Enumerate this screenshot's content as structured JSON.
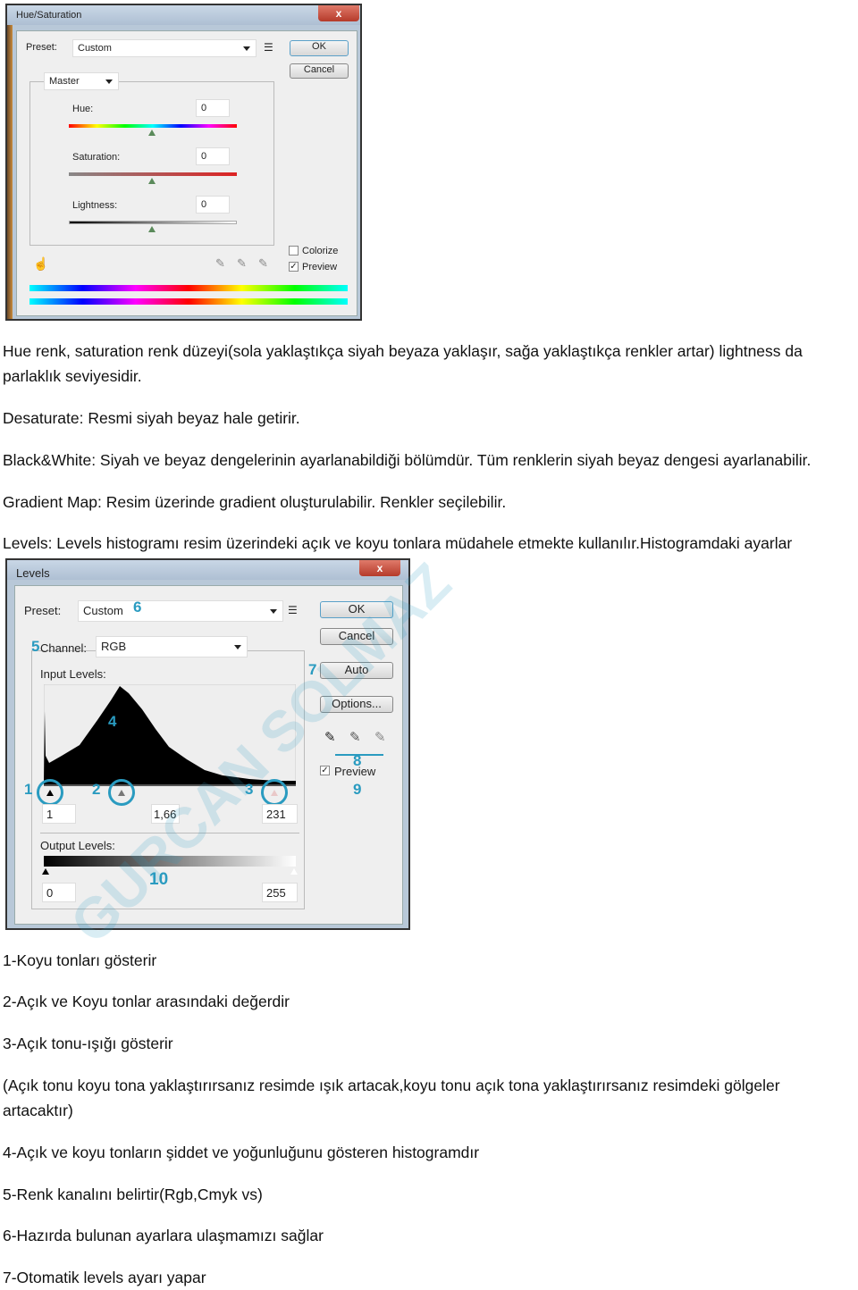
{
  "hue_dialog": {
    "title": "Hue/Saturation",
    "close": "x",
    "preset_label": "Preset:",
    "preset_value": "Custom",
    "ok": "OK",
    "cancel": "Cancel",
    "channel": "Master",
    "hue_label": "Hue:",
    "hue_value": "0",
    "saturation_label": "Saturation:",
    "saturation_value": "0",
    "lightness_label": "Lightness:",
    "lightness_value": "0",
    "colorize_label": "Colorize",
    "colorize_checked": false,
    "preview_label": "Preview",
    "preview_checked": true,
    "icons": [
      "hand-adjust-icon",
      "eyedropper-icon",
      "eyedropper-plus-icon",
      "eyedropper-minus-icon",
      "preset-menu-icon"
    ]
  },
  "paragraphs": [
    "Hue renk, saturation renk düzeyi(sola yaklaştıkça siyah beyaza yaklaşır, sağa yaklaştıkça renkler artar) lightness da",
    "parlaklık seviyesidir.",
    "Desaturate: Resmi siyah beyaz hale getirir.",
    "Black&White: Siyah ve beyaz dengelerinin ayarlanabildiği bölümdür. Tüm renklerin siyah beyaz dengesi ayarlanabilir.",
    "Gradient Map: Resim üzerinde gradient oluşturulabilir. Renkler seçilebilir.",
    "Levels: Levels histogramı resim üzerindeki açık ve koyu tonlara müdahele etmekte kullanılır.Histogramdaki ayarlar"
  ],
  "levels_dialog": {
    "title": "Levels",
    "close": "x",
    "preset_label": "Preset:",
    "preset_value": "Custom",
    "channel_label": "Channel:",
    "channel_value": "RGB",
    "input_levels_label": "Input Levels:",
    "input_black": "1",
    "input_gamma": "1,66",
    "input_white": "231",
    "output_levels_label": "Output Levels:",
    "output_black": "0",
    "output_white": "255",
    "ok": "OK",
    "cancel": "Cancel",
    "auto": "Auto",
    "options": "Options...",
    "preview_label": "Preview",
    "preview_checked": true,
    "watermark": "GURCAN SOLMAZ",
    "markers": [
      "1",
      "2",
      "3",
      "4",
      "5",
      "6",
      "7",
      "8",
      "9",
      "10"
    ],
    "accent": "#2a9bc0"
  },
  "list": [
    "1-Koyu tonları gösterir",
    "2-Açık ve Koyu tonlar arasındaki değerdir",
    "3-Açık tonu-ışığı gösterir",
    "(Açık tonu koyu tona yaklaştırırsanız resimde ışık artacak,koyu tonu açık tona yaklaştırırsanız resimdeki gölgeler",
    "artacaktır)",
    "4-Açık ve koyu tonların şiddet ve yoğunluğunu gösteren histogramdır",
    "5-Renk kanalını belirtir(Rgb,Cmyk vs)",
    "6-Hazırda bulunan ayarlara ulaşmamızı sağlar",
    "7-Otomatik levels ayarı yapar"
  ]
}
